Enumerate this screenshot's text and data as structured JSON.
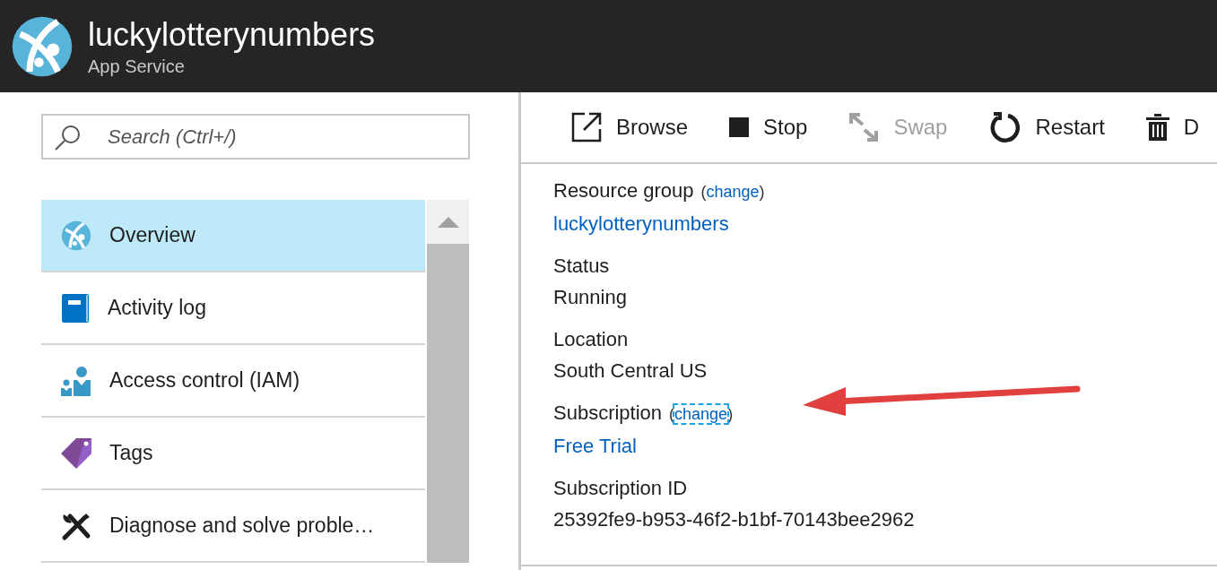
{
  "header": {
    "title": "luckylotterynumbers",
    "subtitle": "App Service"
  },
  "search": {
    "placeholder": "Search (Ctrl+/)"
  },
  "menu": [
    {
      "label": "Overview",
      "kind": "globe",
      "selected": true
    },
    {
      "label": "Activity log",
      "kind": "book",
      "selected": false
    },
    {
      "label": "Access control (IAM)",
      "kind": "people",
      "selected": false
    },
    {
      "label": "Tags",
      "kind": "tag",
      "selected": false
    },
    {
      "label": "Diagnose and solve proble…",
      "kind": "tools",
      "selected": false
    }
  ],
  "toolbar": [
    {
      "label": "Browse",
      "kind": "browse",
      "disabled": false
    },
    {
      "label": "Stop",
      "kind": "stop",
      "disabled": false
    },
    {
      "label": "Swap",
      "kind": "swap",
      "disabled": true
    },
    {
      "label": "Restart",
      "kind": "restart",
      "disabled": false
    },
    {
      "label": "D",
      "kind": "delete",
      "disabled": false
    }
  ],
  "properties": [
    {
      "label": "Resource group",
      "change": {
        "open": "(",
        "text": "change",
        "close": ")",
        "focused": false
      },
      "value": "luckylotterynumbers",
      "kind": "link"
    },
    {
      "label": "Status",
      "value": "Running",
      "kind": "text"
    },
    {
      "label": "Location",
      "value": "South Central US",
      "kind": "text"
    },
    {
      "label": "Subscription",
      "change": {
        "open": "(",
        "text": "change",
        "close": ")",
        "focused": true
      },
      "value": "Free Trial",
      "kind": "link"
    },
    {
      "label": "Subscription ID",
      "value": "25392fe9-b953-46f2-b1bf-70143bee2962",
      "kind": "text"
    }
  ]
}
